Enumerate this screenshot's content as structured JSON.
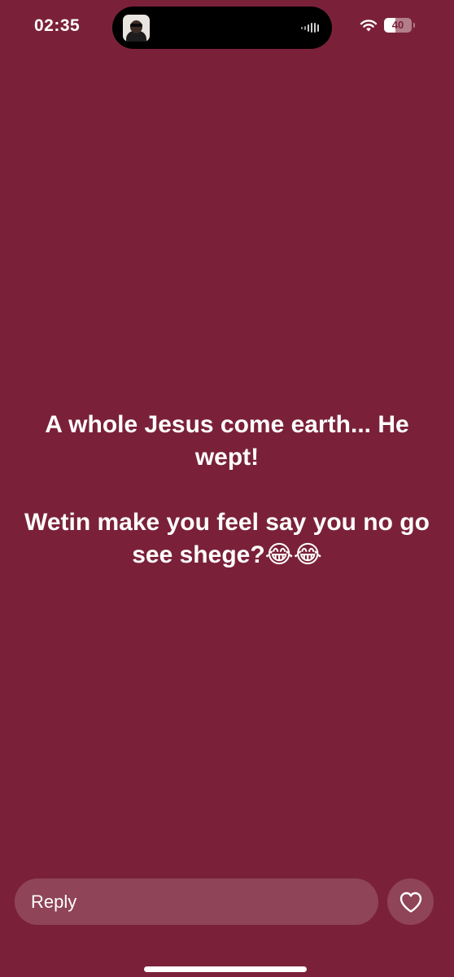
{
  "status_bar": {
    "time": "02:35",
    "battery_level": "40"
  },
  "story": {
    "paragraph1": "A whole Jesus come earth... He wept!",
    "paragraph2": "Wetin make you feel say you no go see shege?😂😂"
  },
  "footer": {
    "reply_label": "Reply"
  },
  "colors": {
    "background": "#7a2139",
    "text": "#ffffff"
  },
  "icons": {
    "wifi": "wifi-icon",
    "battery": "battery-icon",
    "like": "heart-icon",
    "activity": "audio-bars-icon"
  }
}
